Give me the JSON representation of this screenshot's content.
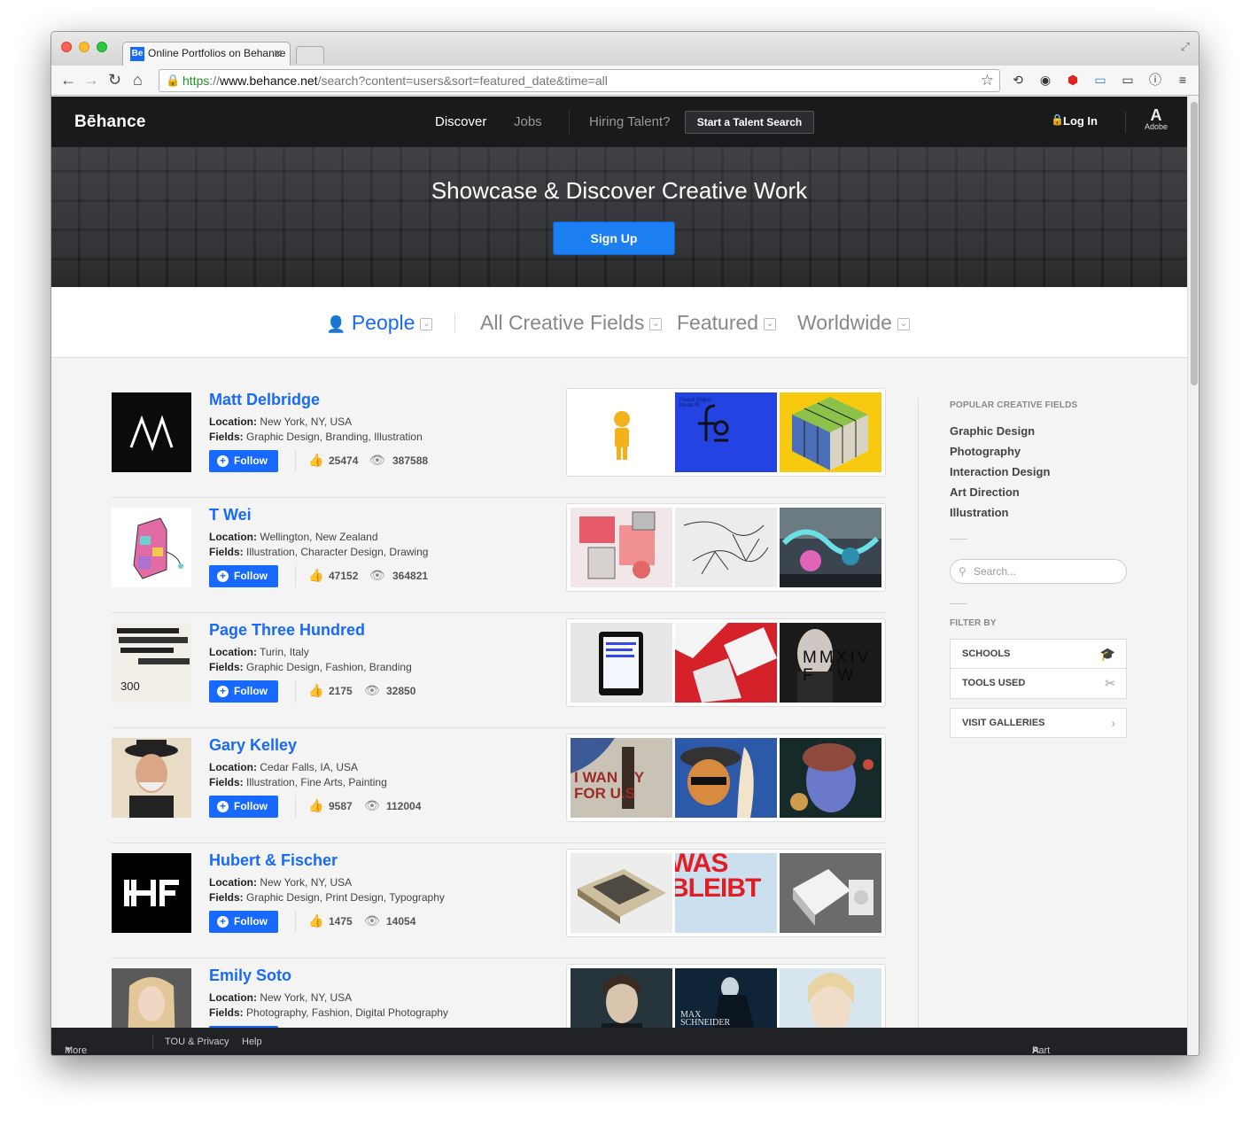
{
  "browser": {
    "tab_title": "Online Portfolios on Behance",
    "favicon_text": "Be",
    "url_scheme": "https",
    "url_sep": "://",
    "url_host": "www.behance.net",
    "url_path": "/search?content=users&sort=featured_date&time=all"
  },
  "header": {
    "logo": "Bēhance",
    "nav": [
      "Discover",
      "Jobs",
      "Hiring Talent?"
    ],
    "talent_button": "Start a Talent Search",
    "login": "Log In",
    "adobe": "Adobe"
  },
  "hero": {
    "title": "Showcase & Discover Creative Work",
    "signup": "Sign Up"
  },
  "filters": {
    "people": "People",
    "fields": "All Creative Fields",
    "sort": "Featured",
    "location": "Worldwide"
  },
  "labels": {
    "location": "Location:",
    "fields": "Fields:",
    "follow": "Follow"
  },
  "people": [
    {
      "name": "Matt Delbridge",
      "location": "New York, NY, USA",
      "fields": "Graphic Design, Branding, Illustration",
      "appreciations": "25474",
      "views": "387588"
    },
    {
      "name": "T Wei",
      "location": "Wellington, New Zealand",
      "fields": "Illustration, Character Design, Drawing",
      "appreciations": "47152",
      "views": "364821"
    },
    {
      "name": "Page Three Hundred",
      "location": "Turin, Italy",
      "fields": "Graphic Design, Fashion, Branding",
      "appreciations": "2175",
      "views": "32850"
    },
    {
      "name": "Gary Kelley",
      "location": "Cedar Falls, IA, USA",
      "fields": "Illustration, Fine Arts, Painting",
      "appreciations": "9587",
      "views": "112004"
    },
    {
      "name": "Hubert & Fischer",
      "location": "New York, NY, USA",
      "fields": "Graphic Design, Print Design, Typography",
      "appreciations": "1475",
      "views": "14054"
    },
    {
      "name": "Emily Soto",
      "location": "New York, NY, USA",
      "fields": "Photography, Fashion, Digital Photography",
      "appreciations": "",
      "views": ""
    }
  ],
  "thumb_text": {
    "page300_avatar": "300",
    "music": "Found Object\nMusic Pl.",
    "mmxiv": "MMXIV\nF   W",
    "iwant": "I WAN    Y\nFOR U.S",
    "was": "WAS\nBLEIBT",
    "max": "MAX\nSCHNEIDER"
  },
  "sidebar": {
    "popular_heading": "POPULAR CREATIVE FIELDS",
    "popular": [
      "Graphic Design",
      "Photography",
      "Interaction Design",
      "Art Direction",
      "Illustration"
    ],
    "search_placeholder": "Search...",
    "filter_heading": "FILTER BY",
    "schools": "SCHOOLS",
    "tools": "TOOLS USED",
    "galleries": "VISIT GALLERIES"
  },
  "footer": {
    "more": "More Behance",
    "tou": "TOU & Privacy",
    "help": "Help",
    "adobe_family": "Part of the Adobe Family"
  },
  "colors": {
    "accent": "#1769ff",
    "header_bg": "#191a1c",
    "signup": "#1c7ff1"
  },
  "icons": [
    "lock-icon",
    "star-icon",
    "person-icon",
    "thumbs-up-icon",
    "eye-icon",
    "plus-icon",
    "search-icon",
    "graduation-cap-icon",
    "tools-icon",
    "chevron-right-icon",
    "adobe-logo-icon"
  ]
}
